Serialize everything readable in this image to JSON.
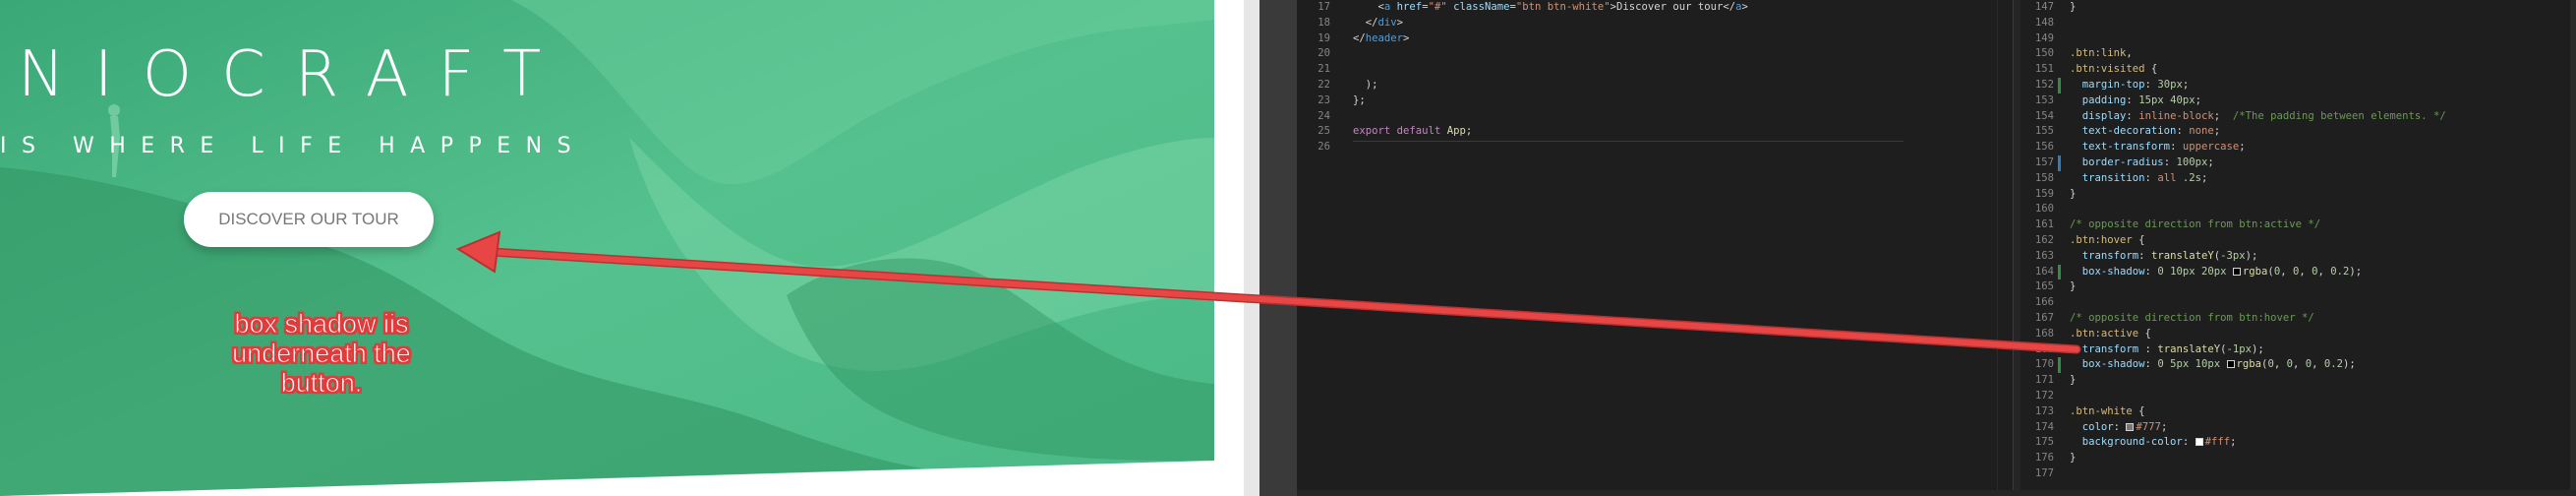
{
  "preview": {
    "brand_title": "NIOCRAFT",
    "subtitle": "IS WHERE LIFE HAPPENS",
    "cta_label": "DISCOVER OUR TOUR",
    "annotation": "box shadow iis underneath the button.",
    "colors": {
      "hero_green": "#4fbe8a",
      "hero_dark": "#2c8e5f",
      "annotation_red": "#e23b3b",
      "arrow_red": "#e84545"
    }
  },
  "editor_left": {
    "lines": [
      {
        "n": "17",
        "html": "    &lt;<span style=\"color:#569cd6\">a</span> <span style=\"color:#9cdcfe\">href</span>=<span style=\"color:#ce9178\">\"#\"</span> <span style=\"color:#9cdcfe\">className</span>=<span style=\"color:#ce9178\">\"btn btn-white\"</span>&gt;Discover our tour&lt;/<span style=\"color:#569cd6\">a</span>&gt;"
      },
      {
        "n": "18",
        "html": "  &lt;/<span style=\"color:#569cd6\">div</span>&gt;"
      },
      {
        "n": "19",
        "html": "&lt;/<span style=\"color:#569cd6\">header</span>&gt;"
      },
      {
        "n": "20",
        "html": ""
      },
      {
        "n": "21",
        "html": ""
      },
      {
        "n": "22",
        "html": "  );"
      },
      {
        "n": "23",
        "html": "};"
      },
      {
        "n": "24",
        "html": ""
      },
      {
        "n": "25",
        "html": "<span style=\"color:#c586c0\">export</span> <span style=\"color:#c586c0\">default</span> <span style=\"color:#dcdcaa\">App</span>;"
      },
      {
        "n": "26",
        "html": ""
      }
    ]
  },
  "editor_right": {
    "lines": [
      {
        "n": "147",
        "html": "}",
        "mark": ""
      },
      {
        "n": "148",
        "html": "",
        "mark": ""
      },
      {
        "n": "149",
        "html": "",
        "mark": ""
      },
      {
        "n": "150",
        "html": "<span style=\"color:#d7ba7d\">.btn:link</span>,",
        "mark": ""
      },
      {
        "n": "151",
        "html": "<span style=\"color:#d7ba7d\">.btn:visited</span> {",
        "mark": ""
      },
      {
        "n": "152",
        "html": "  <span style=\"color:#9cdcfe\">margin-top</span>: <span style=\"color:#b5cea8\">30px</span>;",
        "mark": "green"
      },
      {
        "n": "153",
        "html": "  <span style=\"color:#9cdcfe\">padding</span>: <span style=\"color:#b5cea8\">15px</span> <span style=\"color:#b5cea8\">40px</span>;",
        "mark": ""
      },
      {
        "n": "154",
        "html": "  <span style=\"color:#9cdcfe\">display</span>: <span style=\"color:#ce9178\">inline-block</span>;  <span style=\"color:#6a9955\">/*The padding between elements. */</span>",
        "mark": ""
      },
      {
        "n": "155",
        "html": "  <span style=\"color:#9cdcfe\">text-decoration</span>: <span style=\"color:#ce9178\">none</span>;",
        "mark": ""
      },
      {
        "n": "156",
        "html": "  <span style=\"color:#9cdcfe\">text-transform</span>: <span style=\"color:#ce9178\">uppercase</span>;",
        "mark": ""
      },
      {
        "n": "157",
        "html": "  <span style=\"color:#9cdcfe\">border-radius</span>: <span style=\"color:#b5cea8\">100px</span>;",
        "mark": "blue"
      },
      {
        "n": "158",
        "html": "  <span style=\"color:#9cdcfe\">transition</span>: <span style=\"color:#ce9178\">all</span> <span style=\"color:#b5cea8\">.2s</span>;",
        "mark": ""
      },
      {
        "n": "159",
        "html": "}",
        "mark": ""
      },
      {
        "n": "160",
        "html": "",
        "mark": ""
      },
      {
        "n": "161",
        "html": "<span style=\"color:#6a9955\">/* opposite direction from btn:active */</span>",
        "mark": ""
      },
      {
        "n": "162",
        "html": "<span style=\"color:#d7ba7d\">.btn:hover</span> {",
        "mark": ""
      },
      {
        "n": "163",
        "html": "  <span style=\"color:#9cdcfe\">transform</span>: <span style=\"color:#dcdcaa\">translateY</span>(<span style=\"color:#b5cea8\">-3px</span>);",
        "mark": ""
      },
      {
        "n": "164",
        "html": "  <span style=\"color:#9cdcfe\">box-shadow</span>: <span style=\"color:#b5cea8\">0</span> <span style=\"color:#b5cea8\">10px</span> <span style=\"color:#b5cea8\">20px</span> <span class=\"swatch\" style=\"background:#000\"></span><span style=\"color:#dcdcaa\">rgba</span>(<span style=\"color:#b5cea8\">0</span>, <span style=\"color:#b5cea8\">0</span>, <span style=\"color:#b5cea8\">0</span>, <span style=\"color:#b5cea8\">0.2</span>);",
        "mark": "green"
      },
      {
        "n": "165",
        "html": "}",
        "mark": ""
      },
      {
        "n": "166",
        "html": "",
        "mark": ""
      },
      {
        "n": "167",
        "html": "<span style=\"color:#6a9955\">/* opposite direction from btn:hover */</span>",
        "mark": ""
      },
      {
        "n": "168",
        "html": "<span style=\"color:#d7ba7d\">.btn:active</span> {",
        "mark": ""
      },
      {
        "n": "169",
        "html": "  <span style=\"color:#9cdcfe\">transform</span> : <span style=\"color:#dcdcaa\">translateY</span>(<span style=\"color:#b5cea8\">-1px</span>);",
        "mark": ""
      },
      {
        "n": "170",
        "html": "  <span style=\"color:#9cdcfe\">box-shadow</span>: <span style=\"color:#b5cea8\">0</span> <span style=\"color:#b5cea8\">5px</span> <span style=\"color:#b5cea8\">10px</span> <span class=\"swatch\" style=\"background:#000\"></span><span style=\"color:#dcdcaa\">rgba</span>(<span style=\"color:#b5cea8\">0</span>, <span style=\"color:#b5cea8\">0</span>, <span style=\"color:#b5cea8\">0</span>, <span style=\"color:#b5cea8\">0.2</span>);",
        "mark": "green"
      },
      {
        "n": "171",
        "html": "}",
        "mark": ""
      },
      {
        "n": "172",
        "html": "",
        "mark": ""
      },
      {
        "n": "173",
        "html": "<span style=\"color:#d7ba7d\">.btn-white</span> {",
        "mark": ""
      },
      {
        "n": "174",
        "html": "  <span style=\"color:#9cdcfe\">color</span>: <span class=\"swatch\" style=\"background:#777\"></span><span style=\"color:#ce9178\">#777</span>;",
        "mark": ""
      },
      {
        "n": "175",
        "html": "  <span style=\"color:#9cdcfe\">background-color</span>: <span class=\"swatch\" style=\"background:#fff\"></span><span style=\"color:#ce9178\">#fff</span>;",
        "mark": ""
      },
      {
        "n": "176",
        "html": "}",
        "mark": ""
      },
      {
        "n": "177",
        "html": "",
        "mark": ""
      }
    ]
  }
}
